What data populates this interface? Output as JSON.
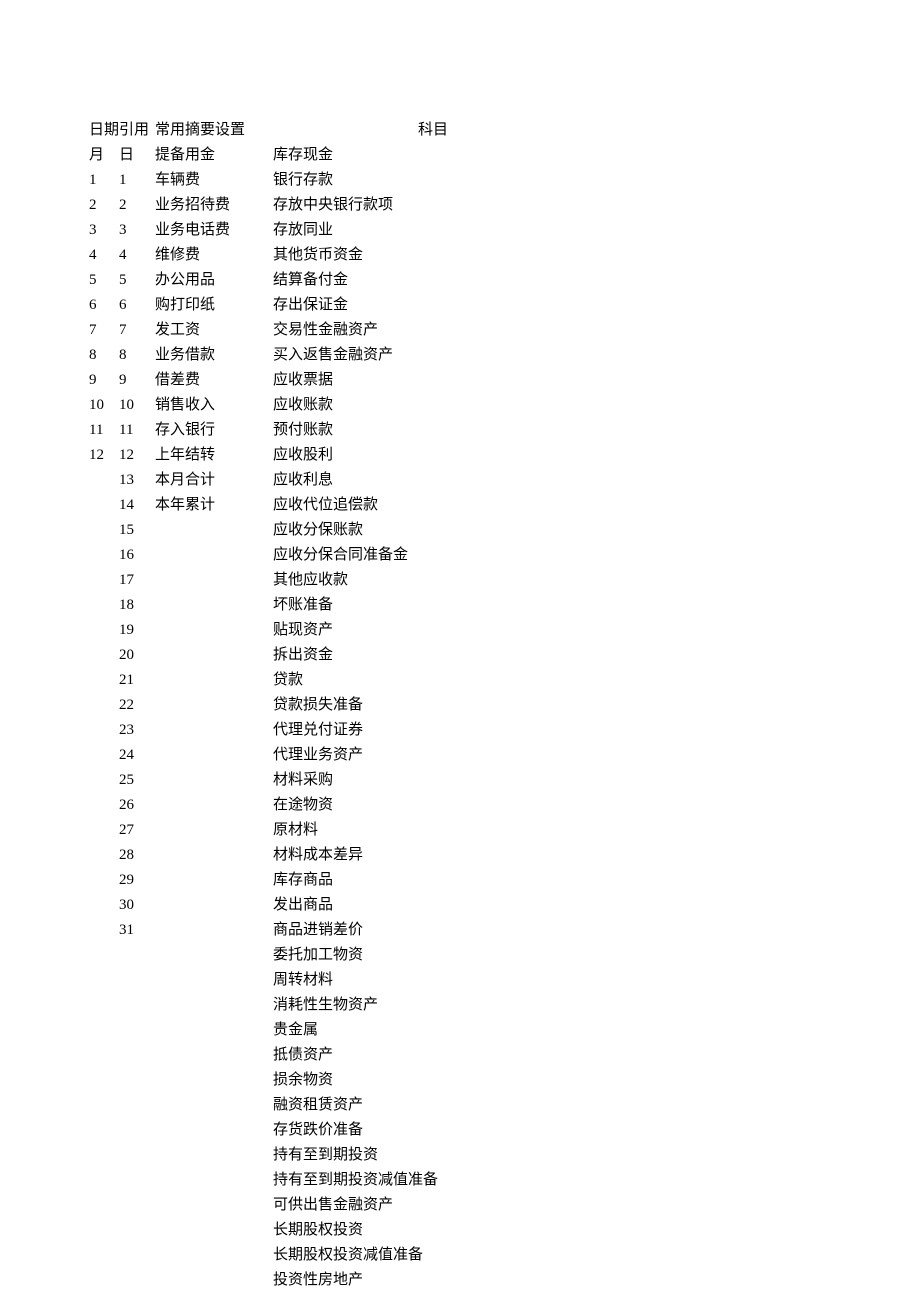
{
  "headers": {
    "date_ref": "日期引用",
    "summary_config": "常用摘要设置",
    "subject": "科目",
    "month": "月",
    "day": "日"
  },
  "months": [
    "1",
    "2",
    "3",
    "4",
    "5",
    "6",
    "7",
    "8",
    "9",
    "10",
    "11",
    "12"
  ],
  "days": [
    "1",
    "2",
    "3",
    "4",
    "5",
    "6",
    "7",
    "8",
    "9",
    "10",
    "11",
    "12",
    "13",
    "14",
    "15",
    "16",
    "17",
    "18",
    "19",
    "20",
    "21",
    "22",
    "23",
    "24",
    "25",
    "26",
    "27",
    "28",
    "29",
    "30",
    "31"
  ],
  "summaries": [
    "提备用金",
    "车辆费",
    "业务招待费",
    "业务电话费",
    "维修费",
    "办公用品",
    "购打印纸",
    "发工资",
    "业务借款",
    "借差费",
    "销售收入",
    "存入银行",
    "上年结转",
    "本月合计",
    "本年累计"
  ],
  "subjects": [
    "库存现金",
    "银行存款",
    "存放中央银行款项",
    "存放同业",
    "其他货币资金",
    "结算备付金",
    "存出保证金",
    "交易性金融资产",
    "买入返售金融资产",
    "应收票据",
    "应收账款",
    "预付账款",
    "应收股利",
    "应收利息",
    "应收代位追偿款",
    "应收分保账款",
    "应收分保合同准备金",
    "其他应收款",
    "坏账准备",
    "贴现资产",
    "拆出资金",
    "贷款",
    "贷款损失准备",
    "代理兑付证券",
    "代理业务资产",
    "材料采购",
    "在途物资",
    "原材料",
    "材料成本差异",
    "库存商品",
    "发出商品",
    "商品进销差价",
    "委托加工物资",
    "周转材料",
    "消耗性生物资产",
    "贵金属",
    "抵债资产",
    "损余物资",
    "融资租赁资产",
    "存货跌价准备",
    "持有至到期投资",
    "持有至到期投资减值准备",
    "可供出售金融资产",
    "长期股权投资",
    "长期股权投资减值准备",
    "投资性房地产"
  ]
}
